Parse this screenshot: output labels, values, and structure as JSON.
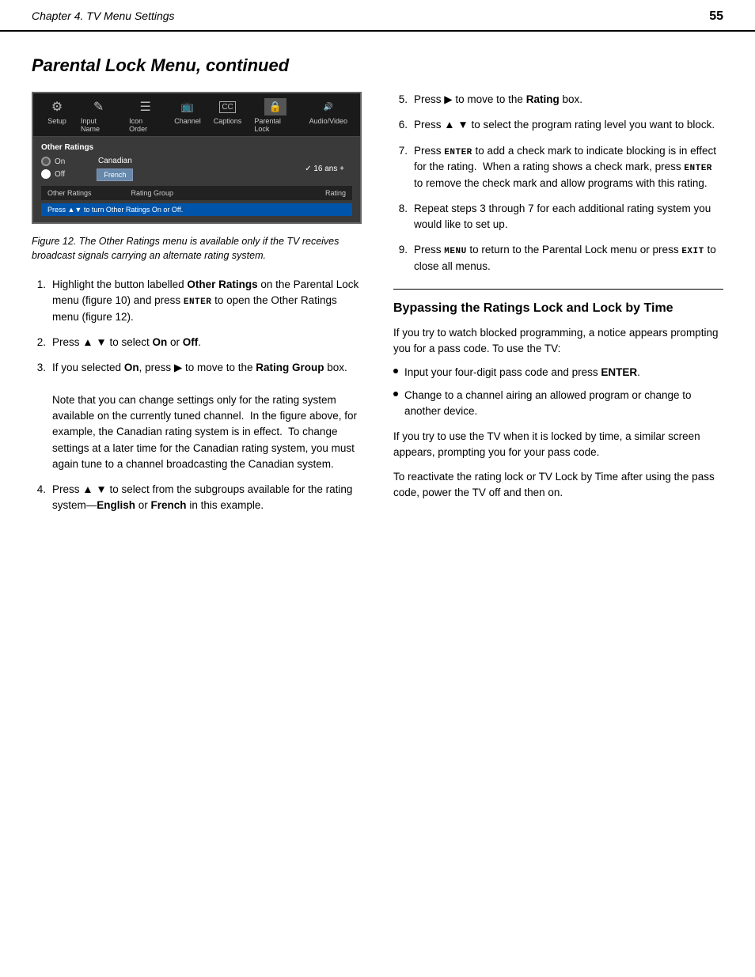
{
  "header": {
    "chapter": "Chapter 4. TV Menu Settings",
    "page": "55"
  },
  "page_title": "Parental Lock Menu, continued",
  "tv_menu": {
    "items": [
      {
        "label": "Setup",
        "icon": "⚙"
      },
      {
        "label": "Input Name",
        "icon": "✎"
      },
      {
        "label": "Icon Order",
        "icon": "☰"
      },
      {
        "label": "Channel",
        "icon": "📡"
      },
      {
        "label": "Captions",
        "icon": "CC"
      },
      {
        "label": "Parental Lock",
        "icon": "🔒"
      },
      {
        "label": "Audio/Video",
        "icon": "🔊"
      }
    ],
    "section_title": "Other Ratings",
    "canadian_label": "Canadian",
    "on_label": "On",
    "off_label": "Off",
    "french_btn": "French",
    "rating_check": "✓ 16 ans +",
    "col1": "Other Ratings",
    "col2": "Rating Group",
    "col3": "Rating",
    "status_bar": "Press ▲▼ to turn Other Ratings On or Off."
  },
  "figure_caption": "Figure 12.  The Other Ratings menu is available only if the TV receives broadcast signals carrying an alternate rating system.",
  "left_steps": [
    {
      "num": "1.",
      "text": "Highlight the button labelled {bold}Other Ratings{/bold} on the Parental Lock menu (figure 10) and press {key}ENTER{/key} to open the Other Ratings menu (figure 12)."
    },
    {
      "num": "2.",
      "text": "Press ▲ ▼ to select {bold}On{/bold} or {bold}Off{/bold}."
    },
    {
      "num": "3.",
      "text": "If you selected {bold}On{/bold}, press ▶ to move to the {bold}Rating Group{/bold} box.\n\nNote that you can change settings only for the rating system available on the currently tuned channel.  In the figure above, for example, the Canadian rating system is in effect.  To change settings at a later time for the Canadian rating system, you must again tune to a channel broadcasting the Canadian system."
    },
    {
      "num": "4.",
      "text": "Press ▲ ▼ to select from the subgroups available for the rating system—{bold}English{/bold} or {bold}French{/bold} in this example."
    }
  ],
  "right_steps": [
    {
      "num": "5.",
      "text": "Press ▶ to move to the {bold}Rating{/bold} box."
    },
    {
      "num": "6.",
      "text": "Press ▲ ▼ to select the program rating level you want to block."
    },
    {
      "num": "7.",
      "text": "Press {key}ENTER{/key} to add a check mark to indicate blocking is in effect for the rating.  When a rating shows a check mark, press {key}ENTER{/key} to remove the check mark and allow programs with this rating."
    },
    {
      "num": "8.",
      "text": "Repeat steps 3 through 7 for each additional rating system you would like to set up."
    },
    {
      "num": "9.",
      "text": "Press {key}MENU{/key} to return to the Parental Lock menu or press {key}EXIT{/key} to close all menus."
    }
  ],
  "bypass_section": {
    "title": "Bypassing the Ratings Lock and Lock by Time",
    "intro": "If you try to watch blocked programming, a notice appears prompting you for a pass code.  To use the TV:",
    "bullets": [
      "Input your four-digit pass code and press {bold}ENTER{/bold}.",
      "Change to a channel airing an allowed program or change to another device."
    ],
    "para2": "If you try to use the TV when it is locked by time, a similar screen appears, prompting you for your pass code.",
    "para3": "To reactivate the rating lock or TV Lock by Time after using the pass code, power the TV off and then on."
  }
}
